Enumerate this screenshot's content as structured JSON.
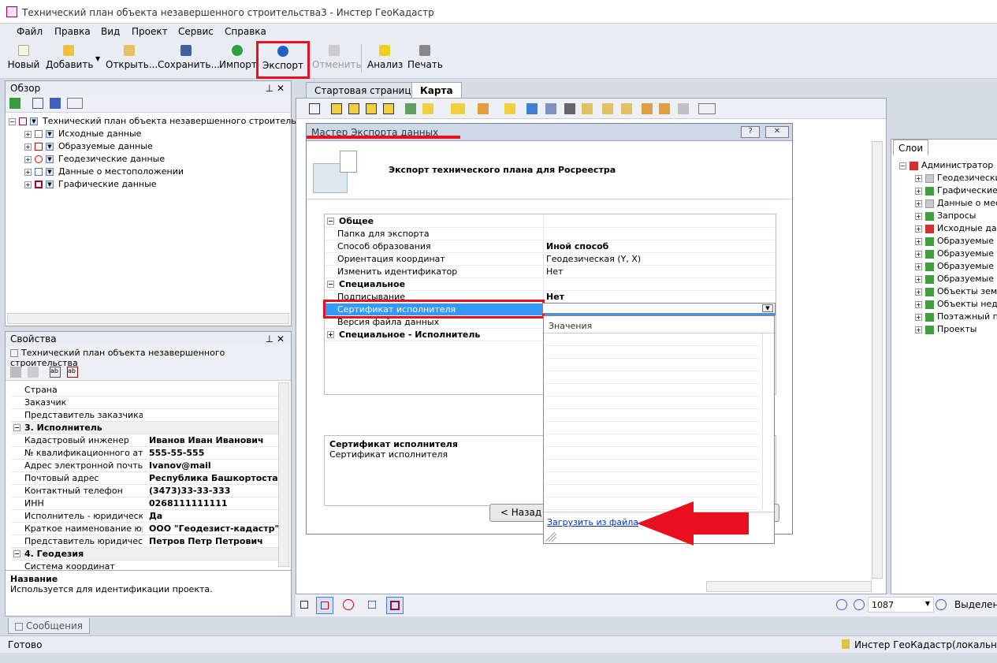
{
  "window": {
    "title": "Технический план объекта незавершенного строительства3 - Инстер ГеоКадастр"
  },
  "menu": [
    "Файл",
    "Правка",
    "Вид",
    "Проект",
    "Сервис",
    "Справка"
  ],
  "toolbar": {
    "new": "Новый",
    "add": "Добавить",
    "open": "Открыть...",
    "save": "Сохранить...",
    "import": "Импорт",
    "export": "Экспорт",
    "undo": "Отменить",
    "analysis": "Анализ",
    "print": "Печать"
  },
  "overview": {
    "title": "Обзор",
    "root": "Технический план объекта незавершенного строительства",
    "items": [
      "Исходные данные",
      "Образуемые данные",
      "Геодезические данные",
      "Данные о местоположении",
      "Графические данные"
    ]
  },
  "properties": {
    "title": "Свойства",
    "subject": "Технический план объекта незавершенного строительства",
    "rows": [
      {
        "k": "Страна",
        "v": ""
      },
      {
        "k": "Заказчик",
        "v": ""
      },
      {
        "k": "Представитель заказчика",
        "v": ""
      },
      {
        "k": "3. Исполнитель",
        "v": "",
        "sec": true
      },
      {
        "k": "Кадастровый инженер",
        "v": "Иванов Иван Иванович"
      },
      {
        "k": "№ квалификационного аттест",
        "v": "555-55-555"
      },
      {
        "k": "Адрес электронной почты",
        "v": "Ivanov@mail"
      },
      {
        "k": "Почтовый адрес",
        "v": "Республика Башкортостан, г"
      },
      {
        "k": "Контактный телефон",
        "v": "(3473)33-33-333"
      },
      {
        "k": "ИНН",
        "v": "0268111111111"
      },
      {
        "k": "Исполнитель - юридическое л",
        "v": "Да"
      },
      {
        "k": "Краткое наименование юриди",
        "v": "ООО \"Геодезист-кадастр\""
      },
      {
        "k": "Представитель юридического",
        "v": "Петров Петр Петрович"
      },
      {
        "k": "4. Геодезия",
        "v": "",
        "sec": true
      },
      {
        "k": "Система координат",
        "v": ""
      }
    ],
    "desc_title": "Название",
    "desc_text": "Используется для идентификации проекта."
  },
  "tabs": [
    "Стартовая страница",
    "Карта"
  ],
  "dialog": {
    "title": "Мастер Экспорта данных",
    "heading": "Экспорт технического плана для Росреестра",
    "grid": [
      {
        "k": "Общее",
        "v": "",
        "sec": true,
        "pm": "⊟"
      },
      {
        "k": "Папка для экспорта",
        "v": ""
      },
      {
        "k": "Способ образования",
        "v": "Иной способ",
        "bold": true
      },
      {
        "k": "Ориентация координат",
        "v": "Геодезическая (Y, X)"
      },
      {
        "k": "Изменить идентификатор",
        "v": "Нет"
      },
      {
        "k": "Специальное",
        "v": "",
        "sec": true,
        "pm": "⊟"
      },
      {
        "k": "Подписывание",
        "v": "Нет",
        "bold": true
      },
      {
        "k": "Сертификат исполнителя",
        "v": "",
        "sel": true
      },
      {
        "k": "Версия файла данных",
        "v": ""
      },
      {
        "k": "Специальное - Исполнитель",
        "v": "",
        "sec": true,
        "pm": "⊞"
      }
    ],
    "desc_title": "Сертификат исполнителя",
    "desc_text": "Сертификат исполнителя",
    "back_button": "< Назад",
    "dropdown_header": "Значения",
    "load_link": "Загрузить из файла"
  },
  "layers": {
    "tab": "Слои",
    "root": "Администратор",
    "items": [
      "Геодезически",
      "Графические",
      "Данные о мес",
      "Запросы",
      "Исходные дан",
      "Образуемые",
      "Образуемые т",
      "Образуемые",
      "Образуемые",
      "Объекты земе",
      "Объекты недв",
      "Поэтажный п",
      "Проекты"
    ]
  },
  "map_status": {
    "zoom": "1087",
    "selection": "Выделенс"
  },
  "messages_tab": "Сообщения",
  "status": {
    "left": "Готово",
    "right": "Инстер ГеоКадастр(локально), А"
  }
}
